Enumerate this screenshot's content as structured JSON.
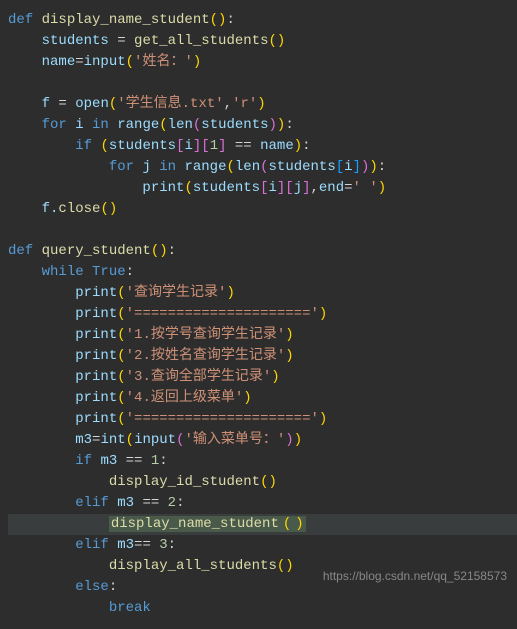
{
  "code": {
    "lines": [
      {
        "indent": 0,
        "tokens": [
          {
            "t": "def ",
            "c": "keyword"
          },
          {
            "t": "display_name_student",
            "c": "func-name"
          },
          {
            "t": "(",
            "c": "paren"
          },
          {
            "t": ")",
            "c": "paren"
          },
          {
            "t": ":",
            "c": "operator"
          }
        ]
      },
      {
        "indent": 1,
        "tokens": [
          {
            "t": "students ",
            "c": "variable"
          },
          {
            "t": "= ",
            "c": "operator"
          },
          {
            "t": "get_all_students",
            "c": "func-name"
          },
          {
            "t": "(",
            "c": "paren"
          },
          {
            "t": ")",
            "c": "paren"
          }
        ]
      },
      {
        "indent": 1,
        "tokens": [
          {
            "t": "name",
            "c": "variable"
          },
          {
            "t": "=",
            "c": "operator"
          },
          {
            "t": "input",
            "c": "builtin"
          },
          {
            "t": "(",
            "c": "paren"
          },
          {
            "t": "'姓名：'",
            "c": "string"
          },
          {
            "t": ")",
            "c": "paren"
          }
        ]
      },
      {
        "indent": 0,
        "tokens": []
      },
      {
        "indent": 1,
        "tokens": [
          {
            "t": "f ",
            "c": "variable"
          },
          {
            "t": "= ",
            "c": "operator"
          },
          {
            "t": "open",
            "c": "builtin"
          },
          {
            "t": "(",
            "c": "paren"
          },
          {
            "t": "'学生信息.txt'",
            "c": "string"
          },
          {
            "t": ",",
            "c": "operator"
          },
          {
            "t": "'r'",
            "c": "string"
          },
          {
            "t": ")",
            "c": "paren"
          }
        ]
      },
      {
        "indent": 1,
        "tokens": [
          {
            "t": "for ",
            "c": "keyword"
          },
          {
            "t": "i ",
            "c": "variable"
          },
          {
            "t": "in ",
            "c": "keyword"
          },
          {
            "t": "range",
            "c": "builtin"
          },
          {
            "t": "(",
            "c": "paren"
          },
          {
            "t": "len",
            "c": "builtin"
          },
          {
            "t": "(",
            "c": "paren2"
          },
          {
            "t": "students",
            "c": "variable"
          },
          {
            "t": ")",
            "c": "paren2"
          },
          {
            "t": ")",
            "c": "paren"
          },
          {
            "t": ":",
            "c": "operator"
          }
        ]
      },
      {
        "indent": 2,
        "tokens": [
          {
            "t": "if ",
            "c": "keyword"
          },
          {
            "t": "(",
            "c": "paren"
          },
          {
            "t": "students",
            "c": "variable"
          },
          {
            "t": "[",
            "c": "paren2"
          },
          {
            "t": "i",
            "c": "variable"
          },
          {
            "t": "]",
            "c": "paren2"
          },
          {
            "t": "[",
            "c": "paren2"
          },
          {
            "t": "1",
            "c": "number"
          },
          {
            "t": "]",
            "c": "paren2"
          },
          {
            "t": " == ",
            "c": "operator"
          },
          {
            "t": "name",
            "c": "variable"
          },
          {
            "t": ")",
            "c": "paren"
          },
          {
            "t": ":",
            "c": "operator"
          }
        ]
      },
      {
        "indent": 3,
        "tokens": [
          {
            "t": "for ",
            "c": "keyword"
          },
          {
            "t": "j ",
            "c": "variable"
          },
          {
            "t": "in ",
            "c": "keyword"
          },
          {
            "t": "range",
            "c": "builtin"
          },
          {
            "t": "(",
            "c": "paren"
          },
          {
            "t": "len",
            "c": "builtin"
          },
          {
            "t": "(",
            "c": "paren2"
          },
          {
            "t": "students",
            "c": "variable"
          },
          {
            "t": "[",
            "c": "paren3"
          },
          {
            "t": "i",
            "c": "variable"
          },
          {
            "t": "]",
            "c": "paren3"
          },
          {
            "t": ")",
            "c": "paren2"
          },
          {
            "t": ")",
            "c": "paren"
          },
          {
            "t": ":",
            "c": "operator"
          }
        ]
      },
      {
        "indent": 4,
        "tokens": [
          {
            "t": "print",
            "c": "builtin"
          },
          {
            "t": "(",
            "c": "paren"
          },
          {
            "t": "students",
            "c": "variable"
          },
          {
            "t": "[",
            "c": "paren2"
          },
          {
            "t": "i",
            "c": "variable"
          },
          {
            "t": "]",
            "c": "paren2"
          },
          {
            "t": "[",
            "c": "paren2"
          },
          {
            "t": "j",
            "c": "variable"
          },
          {
            "t": "]",
            "c": "paren2"
          },
          {
            "t": ",",
            "c": "operator"
          },
          {
            "t": "end",
            "c": "variable"
          },
          {
            "t": "=",
            "c": "operator"
          },
          {
            "t": "' '",
            "c": "string"
          },
          {
            "t": ")",
            "c": "paren"
          }
        ]
      },
      {
        "indent": 1,
        "tokens": [
          {
            "t": "f.",
            "c": "variable"
          },
          {
            "t": "close",
            "c": "func-name"
          },
          {
            "t": "(",
            "c": "paren"
          },
          {
            "t": ")",
            "c": "paren"
          }
        ]
      },
      {
        "indent": 0,
        "tokens": []
      },
      {
        "indent": 0,
        "tokens": [
          {
            "t": "def ",
            "c": "keyword"
          },
          {
            "t": "query_student",
            "c": "func-name"
          },
          {
            "t": "(",
            "c": "paren"
          },
          {
            "t": ")",
            "c": "paren"
          },
          {
            "t": ":",
            "c": "operator"
          }
        ]
      },
      {
        "indent": 1,
        "tokens": [
          {
            "t": "while ",
            "c": "keyword"
          },
          {
            "t": "True",
            "c": "const"
          },
          {
            "t": ":",
            "c": "operator"
          }
        ]
      },
      {
        "indent": 2,
        "tokens": [
          {
            "t": "print",
            "c": "builtin"
          },
          {
            "t": "(",
            "c": "paren"
          },
          {
            "t": "'查询学生记录'",
            "c": "string"
          },
          {
            "t": ")",
            "c": "paren"
          }
        ]
      },
      {
        "indent": 2,
        "tokens": [
          {
            "t": "print",
            "c": "builtin"
          },
          {
            "t": "(",
            "c": "paren"
          },
          {
            "t": "'====================='",
            "c": "string"
          },
          {
            "t": ")",
            "c": "paren"
          }
        ]
      },
      {
        "indent": 2,
        "tokens": [
          {
            "t": "print",
            "c": "builtin"
          },
          {
            "t": "(",
            "c": "paren"
          },
          {
            "t": "'1.按学号查询学生记录'",
            "c": "string"
          },
          {
            "t": ")",
            "c": "paren"
          }
        ]
      },
      {
        "indent": 2,
        "tokens": [
          {
            "t": "print",
            "c": "builtin"
          },
          {
            "t": "(",
            "c": "paren"
          },
          {
            "t": "'2.按姓名查询学生记录'",
            "c": "string"
          },
          {
            "t": ")",
            "c": "paren"
          }
        ]
      },
      {
        "indent": 2,
        "tokens": [
          {
            "t": "print",
            "c": "builtin"
          },
          {
            "t": "(",
            "c": "paren"
          },
          {
            "t": "'3.查询全部学生记录'",
            "c": "string"
          },
          {
            "t": ")",
            "c": "paren"
          }
        ]
      },
      {
        "indent": 2,
        "tokens": [
          {
            "t": "print",
            "c": "builtin"
          },
          {
            "t": "(",
            "c": "paren"
          },
          {
            "t": "'4.返回上级菜单'",
            "c": "string"
          },
          {
            "t": ")",
            "c": "paren"
          }
        ]
      },
      {
        "indent": 2,
        "tokens": [
          {
            "t": "print",
            "c": "builtin"
          },
          {
            "t": "(",
            "c": "paren"
          },
          {
            "t": "'====================='",
            "c": "string"
          },
          {
            "t": ")",
            "c": "paren"
          }
        ]
      },
      {
        "indent": 2,
        "tokens": [
          {
            "t": "m3",
            "c": "variable"
          },
          {
            "t": "=",
            "c": "operator"
          },
          {
            "t": "int",
            "c": "builtin"
          },
          {
            "t": "(",
            "c": "paren"
          },
          {
            "t": "input",
            "c": "builtin"
          },
          {
            "t": "(",
            "c": "paren2"
          },
          {
            "t": "'输入菜单号：'",
            "c": "string"
          },
          {
            "t": ")",
            "c": "paren2"
          },
          {
            "t": ")",
            "c": "paren"
          }
        ]
      },
      {
        "indent": 2,
        "tokens": [
          {
            "t": "if ",
            "c": "keyword"
          },
          {
            "t": "m3 ",
            "c": "variable"
          },
          {
            "t": "== ",
            "c": "operator"
          },
          {
            "t": "1",
            "c": "number"
          },
          {
            "t": ":",
            "c": "operator"
          }
        ]
      },
      {
        "indent": 3,
        "tokens": [
          {
            "t": "display_id_student",
            "c": "func-name"
          },
          {
            "t": "(",
            "c": "paren"
          },
          {
            "t": ")",
            "c": "paren"
          }
        ]
      },
      {
        "indent": 2,
        "tokens": [
          {
            "t": "elif ",
            "c": "keyword"
          },
          {
            "t": "m3 ",
            "c": "variable"
          },
          {
            "t": "== ",
            "c": "operator"
          },
          {
            "t": "2",
            "c": "number"
          },
          {
            "t": ":",
            "c": "operator"
          }
        ]
      },
      {
        "indent": 3,
        "highlight": true,
        "tokens": [
          {
            "t": "display_name_student",
            "c": "func-name",
            "hl": true
          },
          {
            "t": "(",
            "c": "paren",
            "hl": true
          },
          {
            "t": ")",
            "c": "paren",
            "hl": true
          }
        ]
      },
      {
        "indent": 2,
        "tokens": [
          {
            "t": "elif ",
            "c": "keyword"
          },
          {
            "t": "m3",
            "c": "variable"
          },
          {
            "t": "== ",
            "c": "operator"
          },
          {
            "t": "3",
            "c": "number"
          },
          {
            "t": ":",
            "c": "operator"
          }
        ]
      },
      {
        "indent": 3,
        "tokens": [
          {
            "t": "display_all_students",
            "c": "func-name"
          },
          {
            "t": "(",
            "c": "paren"
          },
          {
            "t": ")",
            "c": "paren"
          }
        ]
      },
      {
        "indent": 2,
        "tokens": [
          {
            "t": "else",
            "c": "keyword"
          },
          {
            "t": ":",
            "c": "operator"
          }
        ]
      },
      {
        "indent": 3,
        "tokens": [
          {
            "t": "break",
            "c": "keyword"
          }
        ]
      }
    ]
  },
  "watermark": "https://blog.csdn.net/qq_52158573",
  "indentSize": "    "
}
